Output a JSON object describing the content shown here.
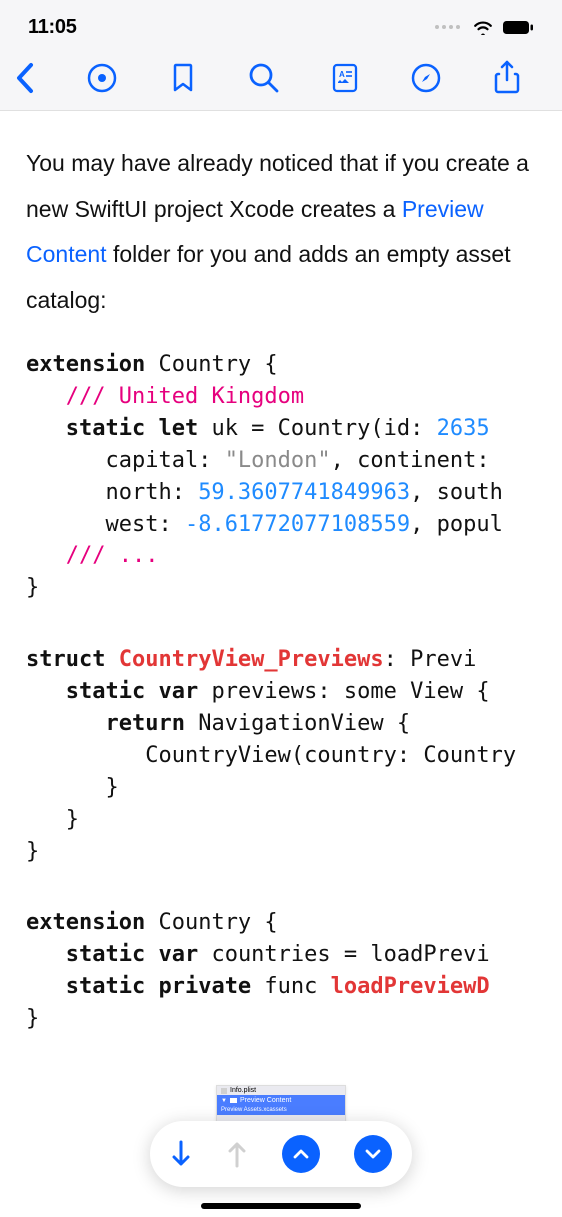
{
  "status": {
    "time": "11:05"
  },
  "content": {
    "para_pre": "You may have already noticed that if you create a new SwiftUI project Xcode creates a ",
    "para_link": "Preview Content",
    "para_post": " folder for you and adds an empty asset catalog:"
  },
  "code1": {
    "l1_a": "extension",
    "l1_b": " Country {",
    "l2_a": "   ///",
    "l2_b": " United Kingdom",
    "l3_a": "   static",
    "l3_b": " let",
    "l3_c": " uk = Country(id: ",
    "l3_d": "2635",
    "l4_a": "      capital: ",
    "l4_b": "\"London\"",
    "l4_c": ", continent:",
    "l5_a": "      north: ",
    "l5_b": "59.3607741849963",
    "l5_c": ", south",
    "l6_a": "      west: ",
    "l6_b": "-8.61772077108559",
    "l6_c": ", popul",
    "l7_a": "   ///",
    "l7_b": " ...",
    "l8": "}"
  },
  "code2": {
    "l1_a": "struct",
    "l1_b": " CountryView_Previews",
    "l1_c": ": Previ",
    "l2_a": "   static",
    "l2_b": " var",
    "l2_c": " previews: some View {",
    "l3_a": "      return",
    "l3_b": " NavigationView {",
    "l4": "         CountryView(country: Country",
    "l5": "      }",
    "l6": "   }",
    "l7": "}"
  },
  "code3": {
    "l1_a": "extension",
    "l1_b": " Country {",
    "l2_a": "   static",
    "l2_b": " var",
    "l2_c": " countries = loadPrevi",
    "l3_a": "   static",
    "l3_b": " private",
    "l3_c": " func",
    "l3_d": " loadPreviewD",
    "l4": "}"
  },
  "thumbnail": {
    "row1": "Info.plist",
    "row2": "Preview Content",
    "row3": "Preview Assets.xcassets"
  }
}
